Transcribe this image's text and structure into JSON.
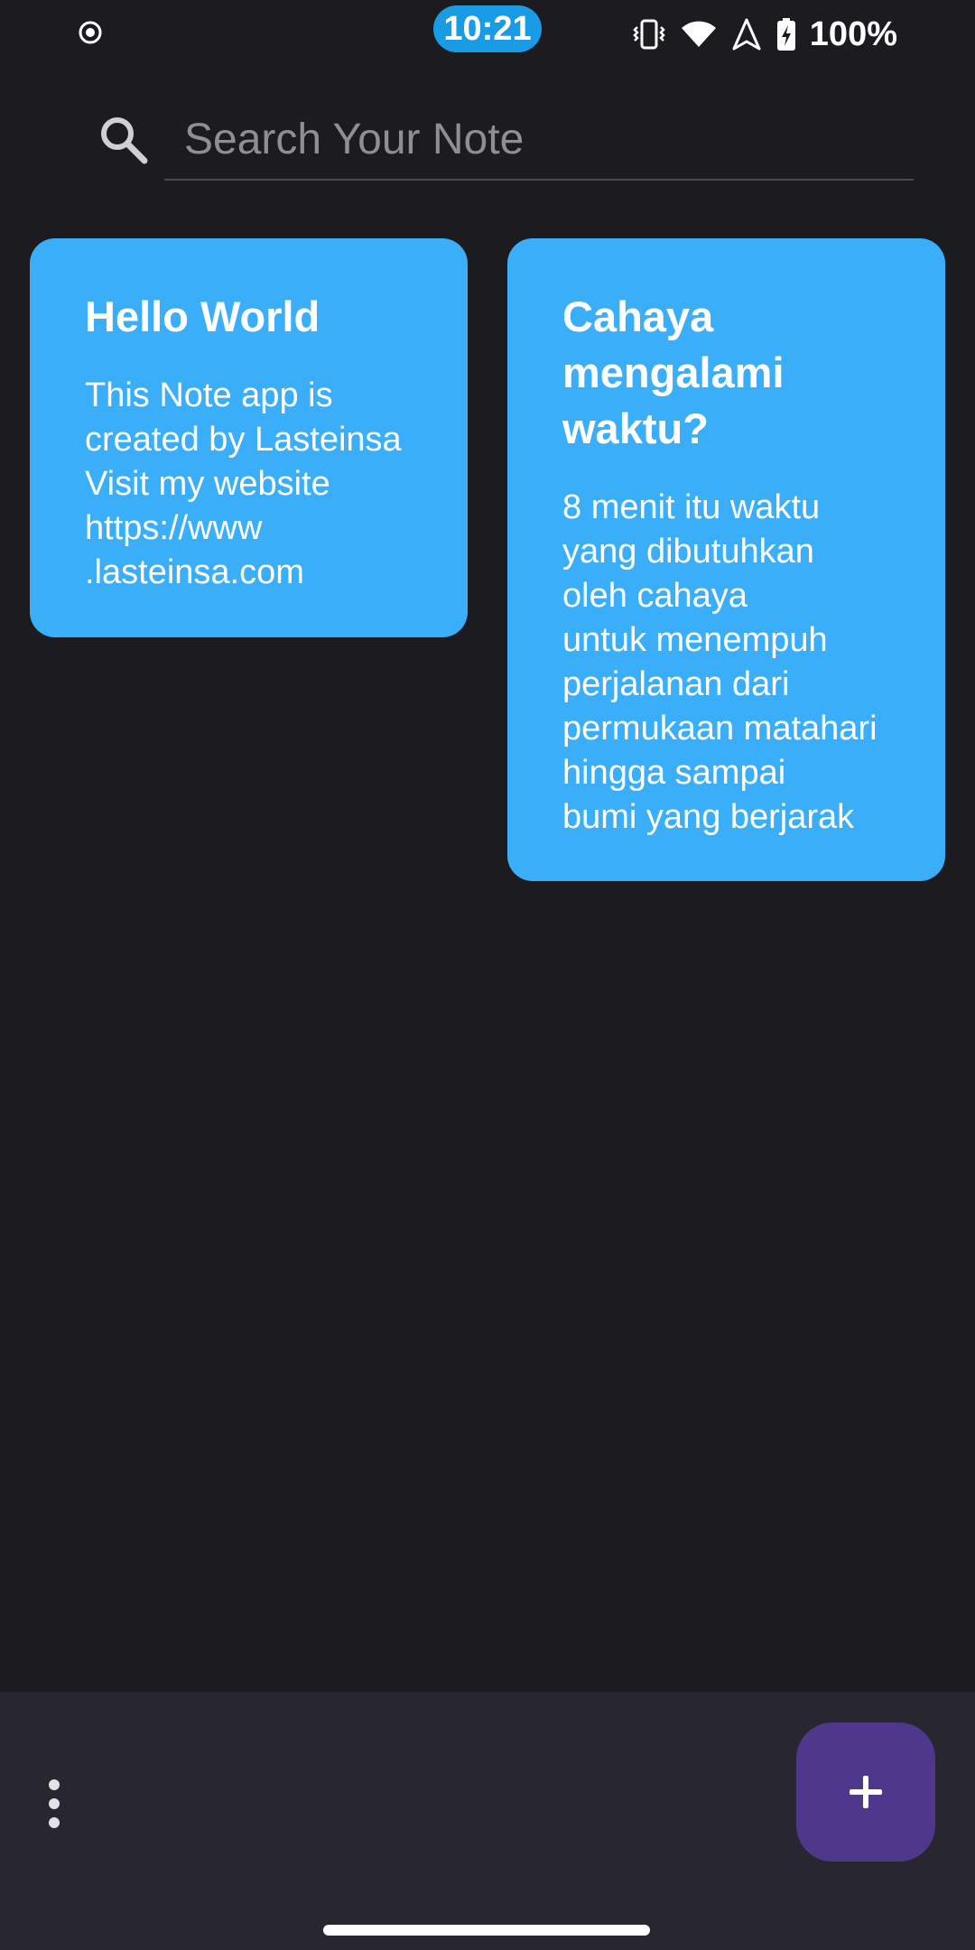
{
  "status_bar": {
    "time": "10:21",
    "battery_percent": "100%",
    "icons": [
      "record-icon",
      "vibrate-icon",
      "wifi-icon",
      "navigation-icon",
      "battery-charging-icon"
    ],
    "time_pill_color": "#1a9be6"
  },
  "search": {
    "placeholder": "Search Your Note",
    "value": ""
  },
  "notes": [
    {
      "title": "Hello World",
      "body": "This Note app is\ncreated by Lasteinsa\nVisit my website\nhttps://www\n.lasteinsa.com",
      "color": "#3aaef8"
    },
    {
      "title": "Cahaya\nmengalami\nwaktu?",
      "body": "8 menit itu waktu\nyang dibutuhkan\noleh cahaya\nuntuk menempuh\nperjalanan dari\npermukaan matahari\nhingga sampai\nbumi yang berjarak",
      "color": "#3aaef8"
    }
  ],
  "bottom_bar": {
    "menu_icon": "more-vert-icon",
    "fab_icon": "add-icon",
    "fab_color": "#4f378b"
  },
  "colors": {
    "background": "#1c1b20",
    "bottom_bar": "#28272f"
  }
}
